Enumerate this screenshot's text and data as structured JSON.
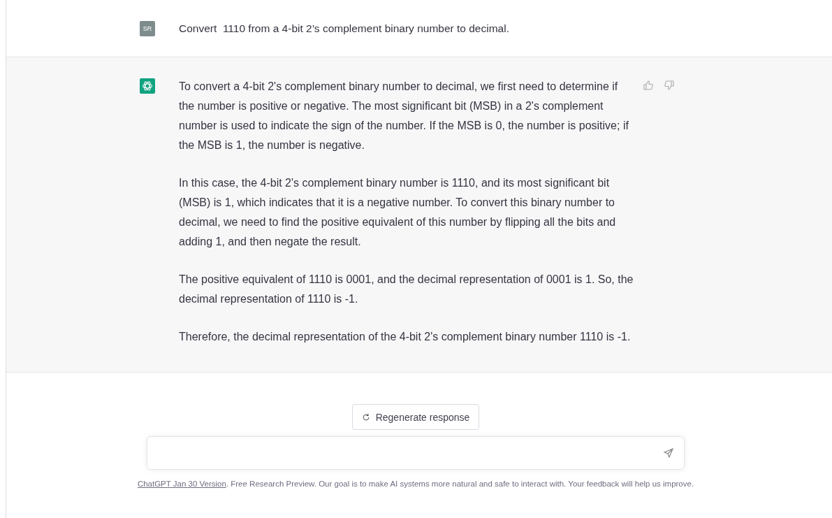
{
  "user_message": {
    "avatar": "SR",
    "text": "Convert  1110 from a 4-bit 2’s complement binary number to decimal."
  },
  "assistant_message": {
    "paragraphs": [
      "To convert a 4-bit 2's complement binary number to decimal, we first need to determine if the number is positive or negative. The most significant bit (MSB) in a 2's complement number is used to indicate the sign of the number. If the MSB is 0, the number is positive; if the MSB is 1, the number is negative.",
      "In this case, the 4-bit 2's complement binary number is 1110, and its most significant bit (MSB) is 1, which indicates that it is a negative number. To convert this binary number to decimal, we need to find the positive equivalent of this number by flipping all the bits and adding 1, and then negate the result.",
      "The positive equivalent of 1110 is 0001, and the decimal representation of 0001 is 1. So, the decimal representation of 1110 is -1.",
      "Therefore, the decimal representation of the 4-bit 2's complement binary number 1110 is -1."
    ]
  },
  "regenerate_button": "Regenerate response",
  "footer": {
    "link": "ChatGPT Jan 30 Version",
    "text": ". Free Research Preview. Our goal is to make AI systems more natural and safe to interact with. Your feedback will help us improve."
  }
}
